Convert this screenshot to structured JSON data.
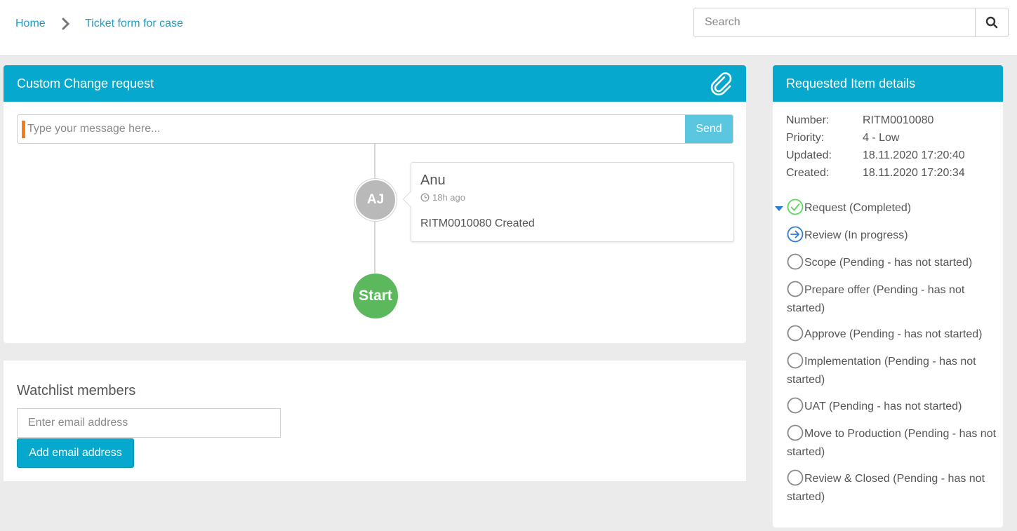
{
  "breadcrumb": {
    "home": "Home",
    "current": "Ticket form for case",
    "separator_icon": "chevron-right-icon"
  },
  "search": {
    "placeholder": "Search",
    "icon": "search-icon"
  },
  "request_panel": {
    "title": "Custom Change request",
    "attach_icon": "paperclip-icon",
    "message_placeholder": "Type your message here...",
    "send_label": "Send",
    "timeline": {
      "entry": {
        "avatar_initials": "AJ",
        "author": "Anu",
        "time": "18h ago",
        "text": "RITM0010080 Created"
      },
      "start_label": "Start"
    }
  },
  "watchlist": {
    "title": "Watchlist members",
    "email_placeholder": "Enter email address",
    "add_label": "Add email address"
  },
  "details_panel": {
    "title": "Requested Item details",
    "fields": [
      {
        "label": "Number:",
        "value": "RITM0010080"
      },
      {
        "label": "Priority:",
        "value": "4 - Low"
      },
      {
        "label": "Updated:",
        "value": "18.11.2020 17:20:40"
      },
      {
        "label": "Created:",
        "value": "18.11.2020 17:20:34"
      }
    ],
    "stages": [
      {
        "label": "Request (Completed)",
        "status": "completed"
      },
      {
        "label": "Review (In progress)",
        "status": "in-progress"
      },
      {
        "label": "Scope (Pending - has not started)",
        "status": "pending"
      },
      {
        "label": "Prepare offer (Pending - has not started)",
        "status": "pending"
      },
      {
        "label": "Approve (Pending - has not started)",
        "status": "pending"
      },
      {
        "label": "Implementation (Pending - has not started)",
        "status": "pending"
      },
      {
        "label": "UAT (Pending - has not started)",
        "status": "pending"
      },
      {
        "label": "Move to Production (Pending - has not started)",
        "status": "pending"
      },
      {
        "label": "Review & Closed (Pending - has not started)",
        "status": "pending"
      }
    ]
  },
  "colors": {
    "accent": "#06a8cd",
    "link": "#1a9fc7",
    "completed": "#5cb85c",
    "in_progress": "#2b7bd8",
    "pending": "#888888",
    "page_bg": "#ebebeb"
  }
}
